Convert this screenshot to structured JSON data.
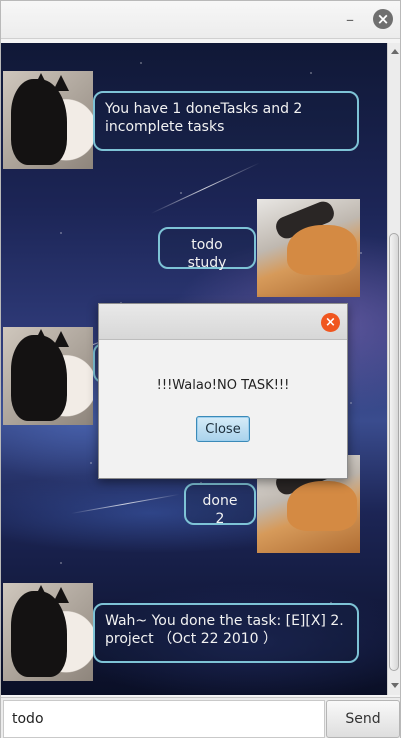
{
  "window": {
    "minimize_icon": "minimize-icon",
    "close_icon": "close-icon"
  },
  "messages": [
    {
      "sender": "bot",
      "text": "You have 1 doneTasks and 2 incomplete tasks"
    },
    {
      "sender": "user",
      "text": "todo study"
    },
    {
      "sender": "bot",
      "text": ""
    },
    {
      "sender": "user",
      "text": "done 2"
    },
    {
      "sender": "bot",
      "text": "Wah~ You done the task:  [E][X] 2. project （Oct 22 2010 ）"
    }
  ],
  "input": {
    "value": "todo",
    "send_label": "Send"
  },
  "dialog": {
    "message": "!!!Walao!NO TASK!!!",
    "close_label": "Close",
    "close_icon": "close-icon"
  },
  "colors": {
    "bubble_border": "#7ec3d6",
    "dialog_close": "#f0561f",
    "dialog_button": "#a9d2ec"
  }
}
